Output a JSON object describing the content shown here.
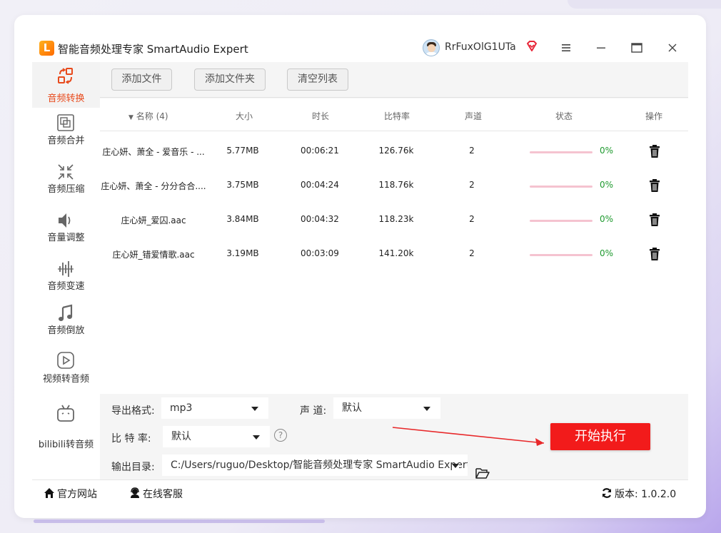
{
  "app": {
    "logo_glyph": "L",
    "title": "智能音频处理专家 SmartAudio Expert",
    "username": "RrFuxOlG1UTa"
  },
  "sidebar": {
    "items": [
      {
        "label": "音频转换",
        "icon": "audio-convert-icon",
        "active": true
      },
      {
        "label": "音频合并",
        "icon": "audio-merge-icon"
      },
      {
        "label": "音频压缩",
        "icon": "audio-compress-icon"
      },
      {
        "label": "音量调整",
        "icon": "volume-icon"
      },
      {
        "label": "音频变速",
        "icon": "waveform-icon"
      },
      {
        "label": "音频倒放",
        "icon": "music-note-icon"
      },
      {
        "label": "视频转音频",
        "icon": "video-play-icon"
      },
      {
        "label": "bilibili转音频",
        "icon": "bilibili-tv-icon"
      }
    ]
  },
  "toolbar": {
    "add_file": "添加文件",
    "add_folder": "添加文件夹",
    "clear_list": "清空列表"
  },
  "table": {
    "headers": {
      "name": "名称 (4)",
      "size": "大小",
      "duration": "时长",
      "bitrate": "比特率",
      "channels": "声道",
      "status": "状态",
      "action": "操作"
    },
    "rows": [
      {
        "name": "庄心妍、萧全 - 爱音乐 - ...",
        "size": "5.77MB",
        "duration": "00:06:21",
        "bitrate": "126.76k",
        "channels": "2",
        "progress": 0,
        "percent": "0%"
      },
      {
        "name": "庄心妍、萧全 - 分分合合....",
        "size": "3.75MB",
        "duration": "00:04:24",
        "bitrate": "118.76k",
        "channels": "2",
        "progress": 0,
        "percent": "0%"
      },
      {
        "name": "庄心妍_爱囚.aac",
        "size": "3.84MB",
        "duration": "00:04:32",
        "bitrate": "118.23k",
        "channels": "2",
        "progress": 0,
        "percent": "0%"
      },
      {
        "name": "庄心妍_错爱情歌.aac",
        "size": "3.19MB",
        "duration": "00:03:09",
        "bitrate": "141.20k",
        "channels": "2",
        "progress": 0,
        "percent": "0%"
      }
    ]
  },
  "settings": {
    "format_label": "导出格式:",
    "format_value": "mp3",
    "channel_label": "声 道:",
    "channel_value": "默认",
    "bitrate_label": "比 特 率:",
    "bitrate_value": "默认",
    "help_glyph": "?",
    "output_label": "输出目录:",
    "output_value": "C:/Users/ruguo/Desktop/智能音频处理专家 SmartAudio Expert",
    "start_button": "开始执行"
  },
  "statusbar": {
    "website": "官方网站",
    "support": "在线客服",
    "version": "版本: 1.0.2.0"
  },
  "colors": {
    "accent_red": "#f21b1b",
    "active_text": "#e84a1c",
    "progress_track": "#f5c3d0",
    "percent_green": "#1f9a2f"
  }
}
